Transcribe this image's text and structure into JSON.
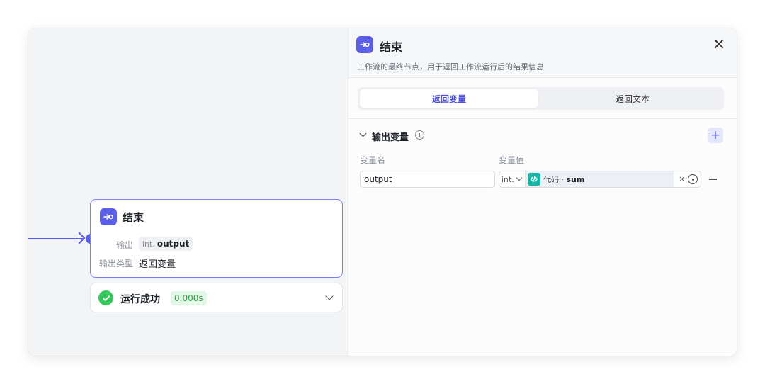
{
  "canvas": {
    "node": {
      "title": "结束",
      "output_label": "输出",
      "output_type": "int.",
      "output_name": "output",
      "output_kind_label": "输出类型",
      "output_kind_value": "返回变量"
    },
    "run_status": {
      "text": "运行成功",
      "time": "0.000s"
    }
  },
  "panel": {
    "title": "结束",
    "description": "工作流的最终节点，用于返回工作流运行后的结果信息",
    "tabs": [
      {
        "label": "返回变量",
        "active": true
      },
      {
        "label": "返回文本",
        "active": false
      }
    ],
    "section_title": "输出变量",
    "columns": {
      "name": "变量名",
      "value": "变量值"
    },
    "row": {
      "name_value": "output",
      "type": "int.",
      "ref_source": "代码",
      "ref_sep": " · ",
      "ref_var": "sum",
      "clear": "×"
    }
  },
  "icons": [
    "end-node-icon",
    "check-icon",
    "chevron-down-icon",
    "close-icon",
    "info-icon",
    "plus-icon",
    "code-icon",
    "target-icon",
    "minus-icon"
  ],
  "colors": {
    "accent": "#5b5ee6",
    "success": "#34c759",
    "code": "#16b5a5"
  }
}
